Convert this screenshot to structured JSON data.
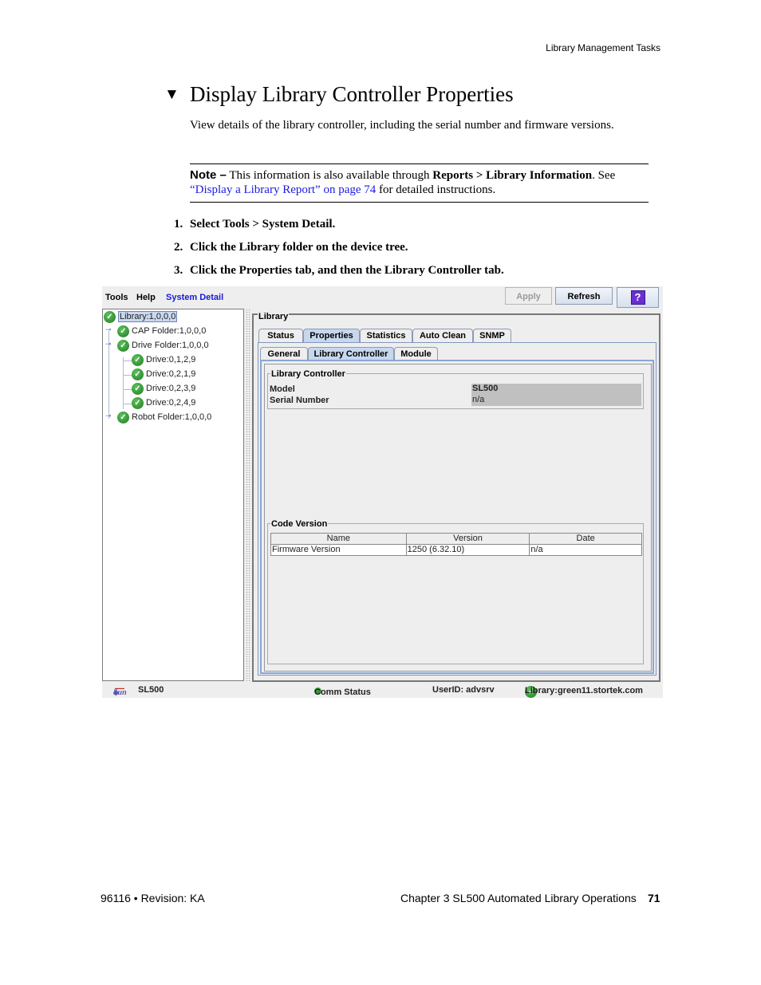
{
  "page_header": "Library Management Tasks",
  "section": {
    "title": "Display Library Controller Properties",
    "intro": "View details of the library controller, including the serial number and firmware versions."
  },
  "note": {
    "label": "Note –",
    "text1": " This information is also available through ",
    "bold": "Reports > Library Information",
    "text2": ". See ",
    "link": "“Display a Library Report” on page 74",
    "text3": " for detailed instructions."
  },
  "steps": [
    {
      "num": "1.",
      "text": "Select Tools > System Detail."
    },
    {
      "num": "2.",
      "text": "Click the Library folder on the device tree."
    },
    {
      "num": "3.",
      "text": "Click the Properties tab, and then the Library Controller tab."
    }
  ],
  "app": {
    "menu": {
      "tools": "Tools",
      "help": "Help",
      "system_detail": "System Detail"
    },
    "buttons": {
      "apply": "Apply",
      "refresh": "Refresh",
      "help": "?"
    },
    "tree": [
      {
        "label": "Library:1,0,0,0",
        "status": "ok",
        "selected": true
      },
      {
        "label": "CAP Folder:1,0,0,0",
        "status": "ok"
      },
      {
        "label": "Drive Folder:1,0,0,0",
        "status": "ok"
      },
      {
        "label": "Drive:0,1,2,9",
        "status": "ok"
      },
      {
        "label": "Drive:0,2,1,9",
        "status": "ok"
      },
      {
        "label": "Drive:0,2,3,9",
        "status": "ok"
      },
      {
        "label": "Drive:0,2,4,9",
        "status": "ok"
      },
      {
        "label": "Robot Folder:1,0,0,0",
        "status": "ok"
      }
    ],
    "panel_title": "Library",
    "tabs": [
      "Status",
      "Properties",
      "Statistics",
      "Auto Clean",
      "SNMP"
    ],
    "active_tab": "Properties",
    "subtabs": [
      "General",
      "Library Controller",
      "Module"
    ],
    "active_subtab": "Library Controller",
    "controller": {
      "legend": "Library Controller",
      "model_label": "Model",
      "model_value": "SL500",
      "serial_label": "Serial Number",
      "serial_value": "n/a"
    },
    "code_version": {
      "legend": "Code Version",
      "columns": [
        "Name",
        "Version",
        "Date"
      ],
      "rows": [
        [
          "Firmware Version",
          "1250 (6.32.10)",
          "n/a"
        ]
      ]
    },
    "status_bar": {
      "product": "SL500",
      "comm_status": "Comm Status",
      "user": "UserID: advsrv",
      "library": "Library:green11.stortek.com",
      "logo": "Sun"
    }
  },
  "footer": {
    "left": "96116 • Revision: KA",
    "chapter": "Chapter 3 SL500 Automated Library Operations",
    "page": "71"
  }
}
